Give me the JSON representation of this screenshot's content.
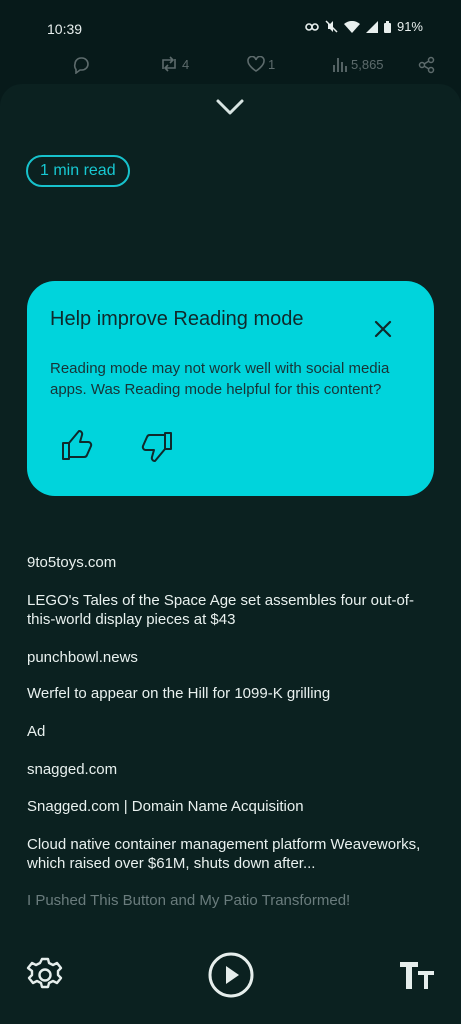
{
  "status_bar": {
    "time": "10:39",
    "battery": "91%"
  },
  "tweet_actions": {
    "retweets": "4",
    "likes": "1",
    "views": "5,865"
  },
  "reading_mode": {
    "read_time": "1 min read",
    "feedback_card": {
      "title": "Help improve Reading mode",
      "body": "Reading mode may not work well with social media apps. Was Reading mode helpful for this content?"
    },
    "content": [
      "9to5toys.com",
      "LEGO's Tales of the Space Age set assembles four out-of-this-world display pieces at $43",
      "punchbowl.news",
      "Werfel to appear on the Hill for 1099-K grilling",
      "Ad",
      "snagged.com",
      "Snagged.com | Domain Name Acquisition",
      "Cloud native container management platform Weaveworks, which raised over $61M, shuts down after...",
      "I Pushed This Button and My Patio Transformed!"
    ]
  },
  "colors": {
    "background": "#071a1a",
    "sheet": "#0b2120",
    "accent": "#17c2cc",
    "card": "#00d4dc"
  },
  "icons": [
    "link-icon",
    "mute-icon",
    "wifi-icon",
    "signal-icon",
    "battery-icon",
    "comment-icon",
    "retweet-icon",
    "heart-icon",
    "views-icon",
    "share-icon",
    "chevron-down-icon",
    "close-icon",
    "thumbs-up-icon",
    "thumbs-down-icon",
    "settings-icon",
    "play-icon",
    "text-size-icon"
  ]
}
